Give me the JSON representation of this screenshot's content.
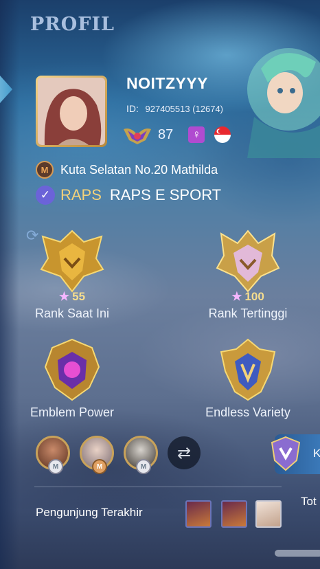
{
  "page": {
    "title": "PROFIL"
  },
  "profile": {
    "name": "NOITZYYY",
    "id_label": "ID:",
    "id_value": "927405513 (12674)",
    "level": "87",
    "gender_icon": "female-symbol-icon",
    "flag": "singapore-flag-icon",
    "location": "Kuta Selatan No.20 Mathilda",
    "squad_tag": "RAPS",
    "squad_name": "RAPS E SPORT"
  },
  "ranks": [
    {
      "stars": "55",
      "label": "Rank Saat Ini",
      "icon": "mythic-rank-badge-icon"
    },
    {
      "stars": "100",
      "label": "Rank Tertinggi",
      "icon": "mythic-glory-badge-icon"
    }
  ],
  "emblems": [
    {
      "label": "Emblem Power",
      "icon": "emblem-power-icon"
    },
    {
      "label": "Endless Variety",
      "icon": "endless-variety-badge-icon"
    }
  ],
  "right_button": {
    "label": "K"
  },
  "visitors": {
    "label": "Pengunjung Terakhir",
    "count_label": "Tot"
  },
  "colors": {
    "accent_gold": "#f4d27a",
    "squad_check": "#6b63d8",
    "gender_bg": "#b04bd0"
  }
}
